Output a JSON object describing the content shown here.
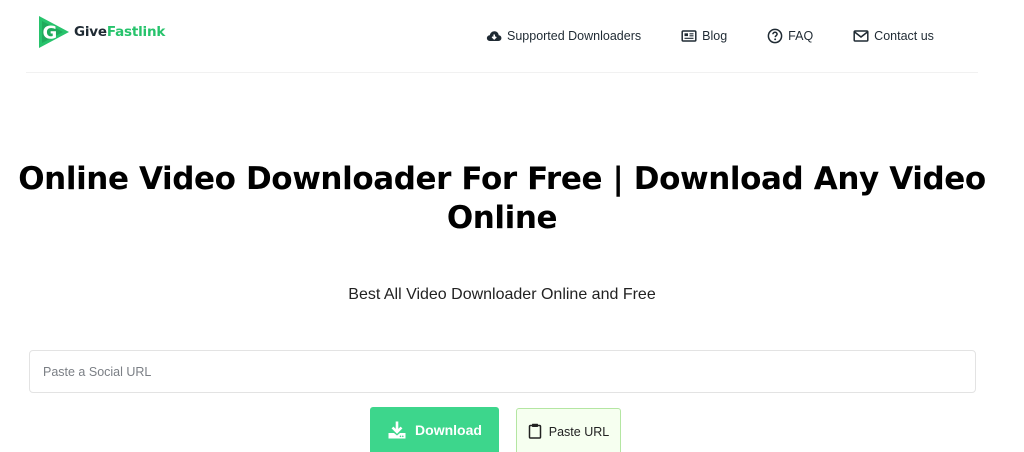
{
  "brand": {
    "name_part1": "Give",
    "name_part2": "Fastlink",
    "accent_color": "#27c36c",
    "logo_icon": "play-g-logo"
  },
  "nav": {
    "items": [
      {
        "label": "Supported Downloaders",
        "icon": "cloud-download-icon"
      },
      {
        "label": "Blog",
        "icon": "newspaper-icon"
      },
      {
        "label": "FAQ",
        "icon": "question-circle-icon"
      },
      {
        "label": "Contact us",
        "icon": "envelope-icon"
      }
    ]
  },
  "hero": {
    "title": "Online Video Downloader For Free | Download Any Video Online",
    "subtitle": "Best All Video Downloader Online and Free"
  },
  "search": {
    "placeholder": "Paste a Social URL",
    "value": ""
  },
  "actions": {
    "download_label": "Download",
    "download_color": "#3dd68c",
    "paste_label": "Paste URL"
  }
}
